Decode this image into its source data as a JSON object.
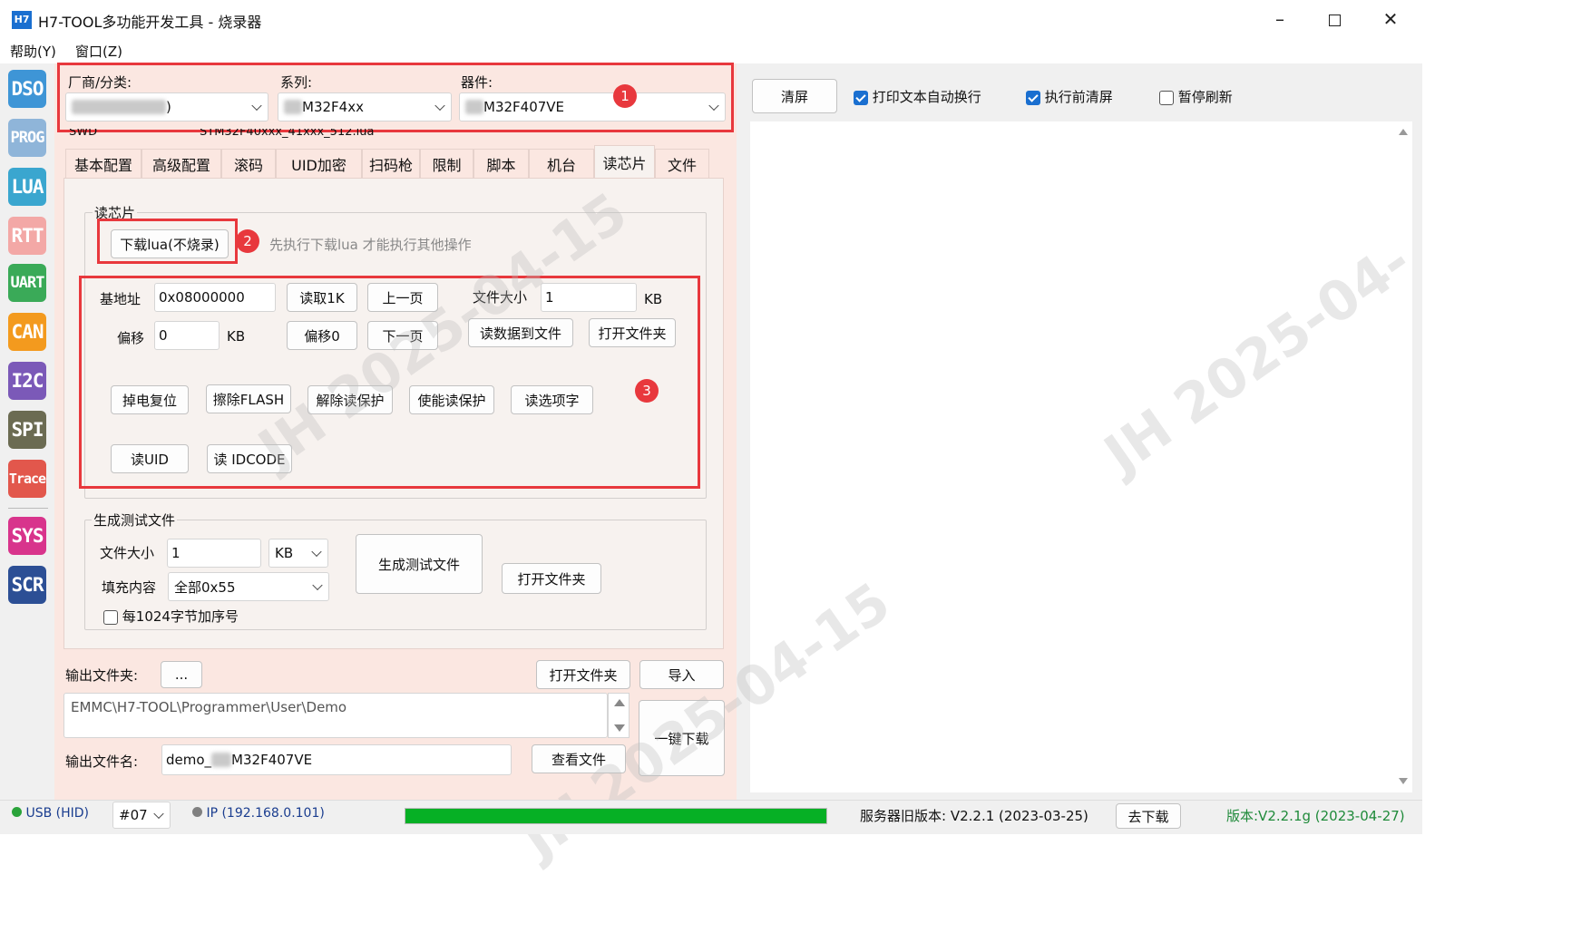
{
  "window": {
    "title": "H7-TOOL多功能开发工具 - 烧录器",
    "app_icon_text": "H7"
  },
  "menu": [
    "帮助(Y)",
    "窗口(Z)"
  ],
  "toolbar": [
    {
      "label": "DSO",
      "color": "#3e95d6"
    },
    {
      "label": "PROG",
      "color": "#8fb5d9"
    },
    {
      "label": "LUA",
      "color": "#3aa6cf"
    },
    {
      "label": "RTT",
      "color": "#f3a8a6"
    },
    {
      "label": "UART",
      "color": "#3aaa58"
    },
    {
      "label": "CAN",
      "color": "#f39a1e"
    },
    {
      "label": "I2C",
      "color": "#7b59b8"
    },
    {
      "label": "SPI",
      "color": "#6b6b52"
    },
    {
      "label": "Trace",
      "color": "#e2574c"
    },
    {
      "label": "SYS",
      "color": "#d8348c"
    },
    {
      "label": "SCR",
      "color": "#2c4f95"
    }
  ],
  "device": {
    "vendor_label": "厂商/分类:",
    "vendor_value": ")",
    "series_label": "系列:",
    "series_value": "M32F4xx",
    "part_label": "器件:",
    "part_value": "M32F407VE",
    "iface": "SWD",
    "algo": "STM32F40xxx_41xxx_512.lua"
  },
  "tabs": [
    "基本配置",
    "高级配置",
    "滚码",
    "UID加密",
    "扫码枪",
    "限制",
    "脚本",
    "机台",
    "读芯片",
    "文件"
  ],
  "active_tab": "读芯片",
  "read_chip": {
    "group_label": "读芯片",
    "download_lua": "下载lua(不烧录)",
    "hint": "先执行下载lua 才能执行其他操作",
    "base_addr_label": "基地址",
    "base_addr_value": "0x08000000",
    "read1k": "读取1K",
    "prev_page": "上一页",
    "file_size_label": "文件大小",
    "file_size_value": "1",
    "kb": "KB",
    "offset_label": "偏移",
    "offset_value": "0",
    "offset0": "偏移0",
    "next_page": "下一页",
    "read_to_file": "读数据到文件",
    "open_folder": "打开文件夹",
    "power_reset": "掉电复位",
    "erase_flash": "擦除FLASH",
    "unprotect": "解除读保护",
    "protect": "使能读保护",
    "read_option": "读选项字",
    "read_uid": "读UID",
    "read_idcode": "读 IDCODE"
  },
  "gen_test": {
    "group_label": "生成测试文件",
    "size_label": "文件大小",
    "size_value": "1",
    "unit": "KB",
    "fill_label": "填充内容",
    "fill_value": "全部0x55",
    "seq_label": "每1024字节加序号",
    "gen_button": "生成测试文件",
    "open_folder": "打开文件夹"
  },
  "output": {
    "folder_label": "输出文件夹:",
    "browse": "...",
    "open_folder": "打开文件夹",
    "import": "导入",
    "path": "EMMC\\H7-TOOL\\Programmer\\User\\Demo",
    "name_label": "输出文件名:",
    "name_prefix": "demo_",
    "name_suffix": "M32F407VE",
    "view_file": "查看文件",
    "one_key": "一键下载"
  },
  "right": {
    "clear": "清屏",
    "opt1": "打印文本自动换行",
    "opt2": "执行前清屏",
    "opt3": "暂停刷新"
  },
  "badges": [
    "1",
    "2",
    "3"
  ],
  "status": {
    "usb": "USB (HID)",
    "port": "#07",
    "ip": "IP (192.168.0.101)",
    "progress": 1.0,
    "server_version": "服务器旧版本: V2.2.1 (2023-03-25)",
    "download": "去下载",
    "version": "版本:V2.2.1g (2023-04-27)"
  },
  "watermark": [
    "JH 2025-04-15",
    "JH 2025-04-15",
    "JH 2025-04-",
    "JH 2025-04-15"
  ]
}
